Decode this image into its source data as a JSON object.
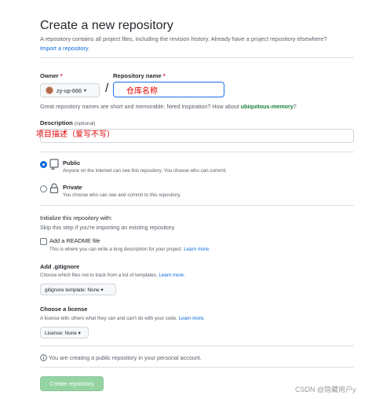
{
  "header": {
    "title": "Create a new repository",
    "subtitle": "A repository contains all project files, including the revision history. Already have a project repository elsewhere?",
    "import_link": "Import a repository."
  },
  "owner": {
    "label": "Owner",
    "required_mark": "*",
    "value": "zy-up-666",
    "caret": "▾"
  },
  "repo_name": {
    "label": "Repository name",
    "required_mark": "*",
    "value": "仓库名称"
  },
  "name_hint": {
    "text": "Great repository names are short and memorable. Need inspiration? How about",
    "suggestion": "ubiquitous-memory",
    "suffix": "?"
  },
  "description": {
    "label": "Description",
    "optional": "(optional)",
    "annotation": "项目描述（爱写不写）"
  },
  "visibility": {
    "public_label": "Public",
    "public_desc": "Anyone on the internet can see this repository. You choose who can commit.",
    "private_label": "Private",
    "private_desc": "You choose who can see and commit to this repository.",
    "selected": "Public"
  },
  "initialize": {
    "title": "Initialize this repository with:",
    "hint": "Skip this step if you're importing an existing repository.",
    "readme_label": "Add a README file",
    "readme_desc": "This is where you can write a long description for your project.",
    "readme_link": "Learn more."
  },
  "gitignore": {
    "title": "Add .gitignore",
    "desc": "Choose which files not to track from a list of templates.",
    "link": "Learn more.",
    "button": "gitignore template: None ▾"
  },
  "license": {
    "title": "Choose a license",
    "desc": "A license tells others what they can and can't do with your code.",
    "link": "Learn more.",
    "button": "License: None ▾"
  },
  "notice": {
    "icon": "info-icon",
    "text": "You are creating a public repository in your personal account."
  },
  "actions": {
    "create": "Create repository"
  },
  "watermark": "CSDN @隐藏用户y",
  "colors": {
    "link": "#0969da",
    "create_button": "#94d3a2",
    "annotation": "#e00000",
    "suggestion": "#1a7f37"
  }
}
